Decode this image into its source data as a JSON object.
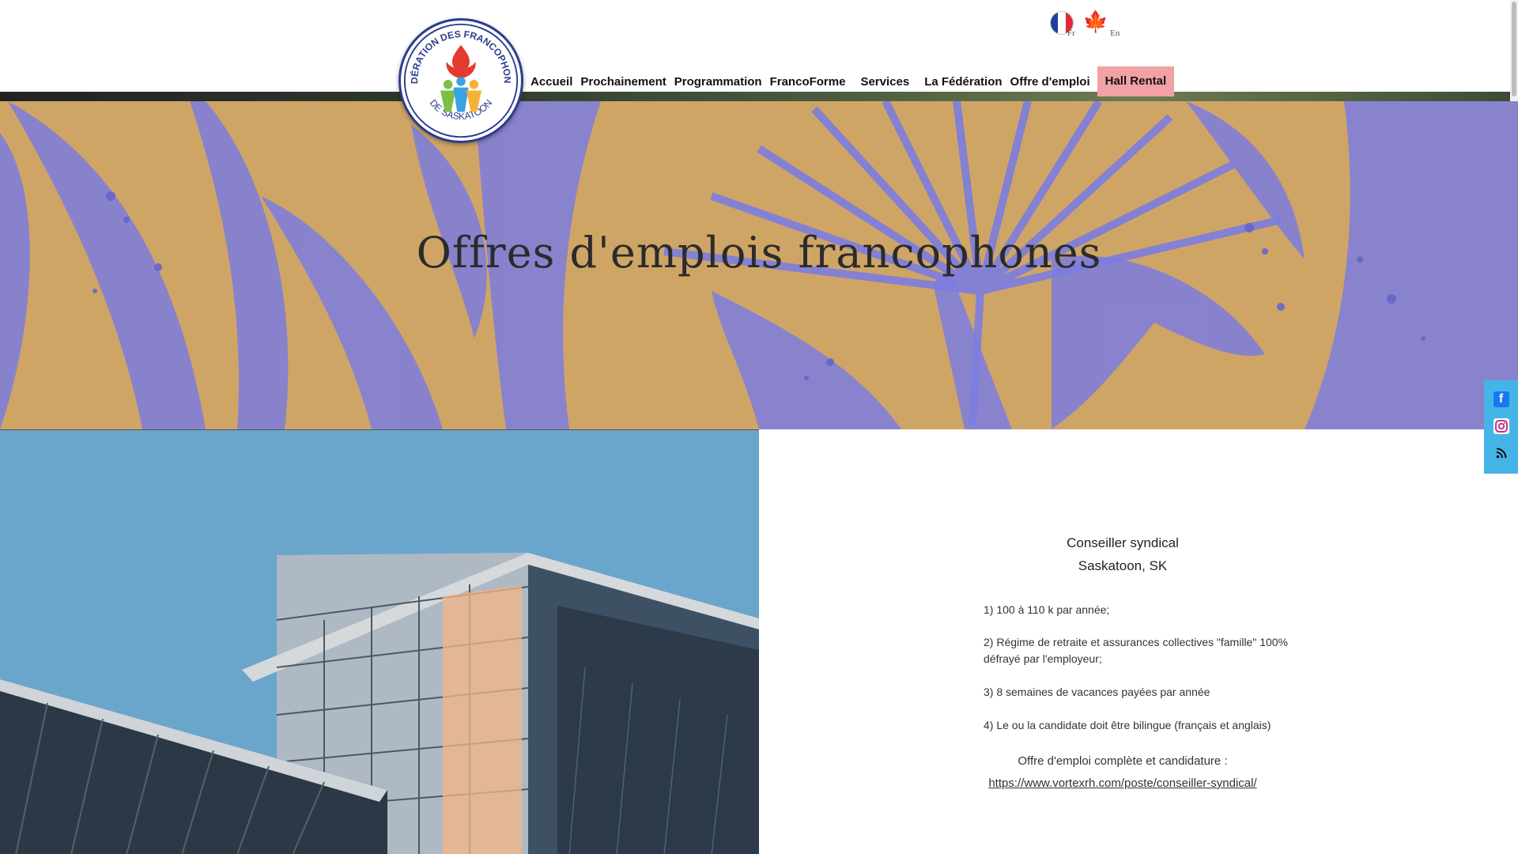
{
  "header": {
    "logo": {
      "arc_top": "FÉDÉRATION DES FRANCOPHONES",
      "arc_bottom": "DE SASKATOON"
    },
    "languages": [
      {
        "label": "Fr",
        "icon": "france-flag-icon"
      },
      {
        "label": "En",
        "icon": "maple-leaf-icon"
      }
    ],
    "nav": [
      {
        "label": "Accueil"
      },
      {
        "label": "Prochainement"
      },
      {
        "label": "Programmation"
      },
      {
        "label": "FrancoForme"
      },
      {
        "label": "Services"
      },
      {
        "label": "La Fédération"
      },
      {
        "label": "Offre d'emploi"
      },
      {
        "label": "Hall Rental"
      }
    ]
  },
  "hero": {
    "title": "Offres d'emplois francophones"
  },
  "job": {
    "title": "Conseiller syndical",
    "location": "Saskatoon, SK",
    "items": [
      "1) 100 à 110 k par année;",
      "2) Régime de retraite et assurances collectives \"famille\" 100% défrayé par l'employeur;",
      "3) 8 semaines de vacances payées par année",
      "4) Le ou la candidate doit être bilingue (français et anglais)"
    ],
    "apply_label": "Offre d'emploi complète et candidature :",
    "apply_link": "https://www.vortexrh.com/poste/conseiller-syndical/"
  },
  "social": [
    {
      "icon": "facebook-icon"
    },
    {
      "icon": "instagram-icon"
    },
    {
      "icon": "rss-icon"
    }
  ],
  "colors": {
    "hero_background": "#c9a063",
    "leaf_color": "#7c7de0",
    "hall_rental": "#f1a1a4",
    "social_bar": "#45b4e6",
    "sky": "#6aa6cc"
  }
}
